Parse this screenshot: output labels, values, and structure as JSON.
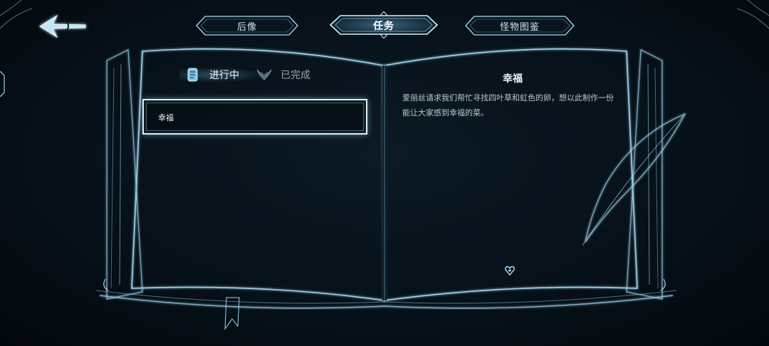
{
  "top_tabs": [
    {
      "label": "后像",
      "active": false
    },
    {
      "label": "任务",
      "active": true
    },
    {
      "label": "怪物图鉴",
      "active": false
    }
  ],
  "status_tabs": {
    "in_progress": "进行中",
    "completed": "已完成",
    "active": "in_progress"
  },
  "quest_list": [
    {
      "title": "幸福",
      "selected": true
    }
  ],
  "quest_detail": {
    "title": "幸福",
    "description": "爱丽丝请求我们帮忙寻找四叶草和虹色的卵，想以此制作一份能让大家感到幸福的菜。"
  },
  "icons": {
    "back": "back-arrow-icon",
    "in_progress": "scroll-icon",
    "completed": "wings-icon",
    "page_marker": "heart-icon",
    "decoration": "feather-quill-icon"
  },
  "colors": {
    "accent": "#9fd6ee",
    "background": "#040a10",
    "text_primary": "#eef6fa",
    "text_secondary": "#b9c8d0"
  }
}
